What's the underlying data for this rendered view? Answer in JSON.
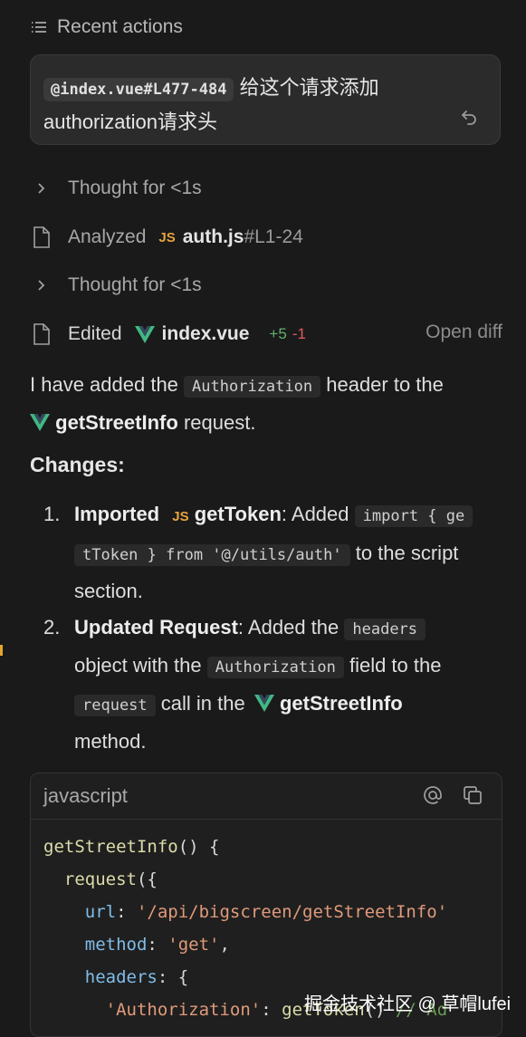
{
  "header": {
    "title": "Recent actions"
  },
  "prompt": {
    "chip": "@index.vue#L477-484",
    "text_line1": "给这个请求添加",
    "text_line2": "authorization请求头"
  },
  "actions": [
    {
      "kind": "thought",
      "label": "Thought for <1s"
    },
    {
      "kind": "analyzed",
      "label": "Analyzed",
      "badge": "JS",
      "file": "auth.js",
      "range": "#L1-24"
    },
    {
      "kind": "thought",
      "label": "Thought for <1s"
    },
    {
      "kind": "edited",
      "label": "Edited",
      "file": "index.vue",
      "plus": "+5",
      "minus": "-1",
      "open_diff": "Open diff"
    }
  ],
  "summary": {
    "p1": "I have added the",
    "code1": "Authorization",
    "p2": "header to the",
    "fn": "getStreetInfo",
    "p3": "request."
  },
  "changes_title": "Changes:",
  "changes": [
    {
      "num": "1.",
      "title": "Imported",
      "badge": "JS",
      "name": "getToken",
      "t1": ": Added",
      "code_a": "import { ge",
      "code_b": "tToken } from '@/utils/auth'",
      "t2": "to the script",
      "t3": "section."
    },
    {
      "num": "2.",
      "title": "Updated Request",
      "t1": ": Added the",
      "code1": "headers",
      "t2": "object with the",
      "code2": "Authorization",
      "t3": "field to the",
      "code3": "request",
      "t4": "call in the",
      "fn": "getStreetInfo",
      "t5": "method."
    }
  ],
  "codeblock": {
    "language": "javascript",
    "lines": {
      "l1_fn": "getStreetInfo",
      "l1_rest": "() {",
      "l2_fn": "request",
      "l2_rest": "({",
      "l3_key": "url",
      "l3_val": "'/api/bigscreen/getStreetInfo'",
      "l4_key": "method",
      "l4_val": "'get'",
      "l5_key": "headers",
      "l6_key": "'Authorization'",
      "l6_fn": "getToken",
      "l6_comment": "// Ad"
    }
  },
  "watermark": "掘金技术社区 @ 草帽lufei",
  "colors": {
    "background": "#1a1a1a",
    "card": "#2b2b2b",
    "js_badge": "#e8a33c",
    "vue_logo": "#41b883",
    "plus": "#5fb36c",
    "minus": "#e05b5b"
  }
}
